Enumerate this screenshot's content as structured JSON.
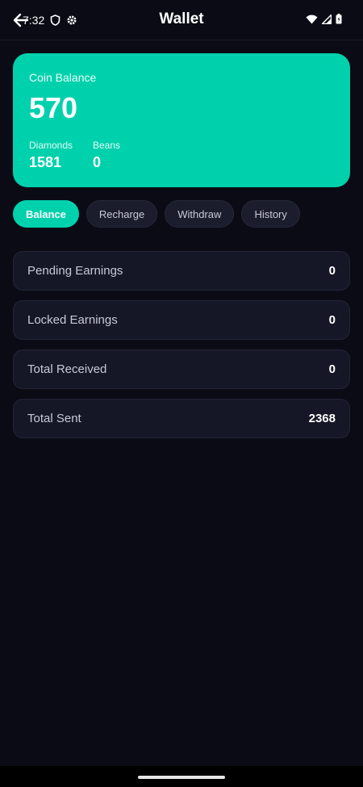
{
  "status_bar": {
    "time": "7:32"
  },
  "header": {
    "title": "Wallet"
  },
  "balance_card": {
    "coin_label": "Coin Balance",
    "coin_value": "570",
    "diamonds_label": "Diamonds",
    "diamonds_value": "1581",
    "beans_label": "Beans",
    "beans_value": "0",
    "color": "#00d1ad"
  },
  "tabs": [
    {
      "label": "Balance",
      "active": true
    },
    {
      "label": "Recharge",
      "active": false
    },
    {
      "label": "Withdraw",
      "active": false
    },
    {
      "label": "History",
      "active": false
    }
  ],
  "stats": [
    {
      "label": "Pending Earnings",
      "value": "0"
    },
    {
      "label": "Locked Earnings",
      "value": "0"
    },
    {
      "label": "Total Received",
      "value": "0"
    },
    {
      "label": "Total Sent",
      "value": "2368"
    }
  ],
  "icons": {
    "back": "arrow-left-icon",
    "shield": "shield-icon",
    "settings": "gear-icon",
    "wifi": "wifi-icon",
    "signal": "signal-icon",
    "battery": "battery-icon"
  }
}
